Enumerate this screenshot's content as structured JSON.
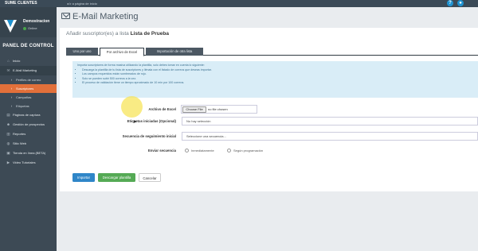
{
  "topbar": {
    "brand": "SUME CLIENTES",
    "link": "◂ Ir a página de inicio",
    "help_icon": "question-icon",
    "user_icon": "user-icon",
    "accent": "#1f93d1"
  },
  "sidebar": {
    "org_name": "Demostracion",
    "status": "Online",
    "panel_title": "PANEL DE CONTROL",
    "items": [
      {
        "label": "Inicio",
        "icon": "home-icon",
        "glyph": "⌂"
      },
      {
        "label": "E-Mail Marketing",
        "icon": "envelope-icon",
        "glyph": "✉"
      },
      {
        "label": "Perfiles de correo",
        "icon": "chevron-right-icon",
        "glyph": "›"
      },
      {
        "label": "Suscriptores",
        "icon": "chevron-right-icon",
        "glyph": "›"
      },
      {
        "label": "Campañas",
        "icon": "chevron-right-icon",
        "glyph": "›"
      },
      {
        "label": "Etiquetas",
        "icon": "chevron-right-icon",
        "glyph": "›"
      },
      {
        "label": "Páginas de captura",
        "icon": "pages-icon",
        "glyph": "▤"
      },
      {
        "label": "Gestión de prospectos",
        "icon": "users-icon",
        "glyph": "☻"
      },
      {
        "label": "Reportes",
        "icon": "chart-icon",
        "glyph": "▥"
      },
      {
        "label": "Sitio Web",
        "icon": "globe-icon",
        "glyph": "◍"
      },
      {
        "label": "Tienda en línea (BETA)",
        "icon": "cart-icon",
        "glyph": "▣"
      },
      {
        "label": "Video Tutoriales",
        "icon": "video-icon",
        "glyph": "▶"
      }
    ],
    "active_color": "#e2703a"
  },
  "main": {
    "page_title": "E-Mail Marketing",
    "card_title_prefix": "Añadir suscriptor(es) a lista",
    "card_title_list": "Lista de Prueba",
    "tabs": [
      "Uno por uno",
      "Por archivo de Excel",
      "Importación de otra lista"
    ],
    "info_intro": "Importa suscriptores de forma masiva utilizando la plantilla, solo debes tomar en cuenta lo siguiente:",
    "info_items": [
      "Descarga la plantilla de tu lista de suscriptores y llénala con el listado de correos que deseas importar.",
      "Los campos requeridos están sombreados de rojo.",
      "Solo se pueden subir 500 correos a la vez.",
      "El proceso de validación tiene un tiempo aproximado de 10 min por 100 correos."
    ],
    "form": {
      "file_label": "Archivo de Excel",
      "file_button": "Choose File",
      "file_status": "no file chosen",
      "tags_label": "Etiquetas iniciadas (Opcional)",
      "tags_value": "No hay selección",
      "sequence_label": "Secuencia de seguimiento inicial",
      "sequence_value": "Seleccione una secuencia...",
      "send_label": "Enviar secuencia",
      "send_options": [
        "Inmediatamente",
        "Según programación"
      ]
    },
    "buttons": {
      "import": "Importar",
      "download": "Descargar plantilla",
      "cancel": "Cancelar"
    }
  }
}
